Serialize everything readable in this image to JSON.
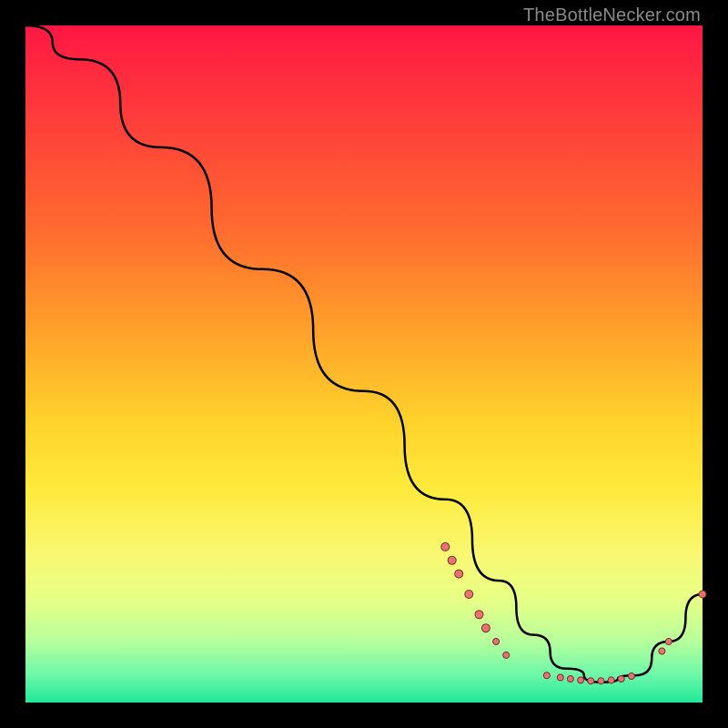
{
  "watermark": "TheBottleNecker.com",
  "chart_data": {
    "type": "line",
    "title": "",
    "xlabel": "",
    "ylabel": "",
    "xlim": [
      0,
      100
    ],
    "ylim": [
      0,
      100
    ],
    "grid": false,
    "series": [
      {
        "name": "",
        "color": "#000000",
        "x": [
          0,
          8,
          20,
          35,
          50,
          62,
          70,
          75,
          80,
          85,
          90,
          95,
          100
        ],
        "y": [
          100,
          95,
          82,
          64,
          46,
          30,
          18,
          10,
          5,
          3,
          4,
          9,
          16
        ]
      }
    ],
    "markers": [
      {
        "x": 62,
        "y": 23,
        "r": 4.5
      },
      {
        "x": 63,
        "y": 21,
        "r": 4.5
      },
      {
        "x": 64,
        "y": 19,
        "r": 4.5
      },
      {
        "x": 65.5,
        "y": 16,
        "r": 4.5
      },
      {
        "x": 67,
        "y": 13,
        "r": 4.5
      },
      {
        "x": 68,
        "y": 11,
        "r": 4.5
      },
      {
        "x": 69.5,
        "y": 9,
        "r": 3.5
      },
      {
        "x": 71,
        "y": 7,
        "r": 3.5
      },
      {
        "x": 77,
        "y": 4,
        "r": 3.5
      },
      {
        "x": 79,
        "y": 3.7,
        "r": 3.5
      },
      {
        "x": 80.5,
        "y": 3.5,
        "r": 3.5
      },
      {
        "x": 82,
        "y": 3.3,
        "r": 3.5
      },
      {
        "x": 83.5,
        "y": 3.2,
        "r": 3.5
      },
      {
        "x": 85,
        "y": 3.2,
        "r": 3.5
      },
      {
        "x": 86.5,
        "y": 3.3,
        "r": 3.5
      },
      {
        "x": 88,
        "y": 3.5,
        "r": 3.5
      },
      {
        "x": 89.5,
        "y": 3.9,
        "r": 3.5
      },
      {
        "x": 94,
        "y": 7.6,
        "r": 3.5
      },
      {
        "x": 95,
        "y": 9,
        "r": 3.5
      },
      {
        "x": 100,
        "y": 16,
        "r": 4
      }
    ],
    "marker_color": "#e77373",
    "marker_stroke": "#7b2f2f"
  }
}
